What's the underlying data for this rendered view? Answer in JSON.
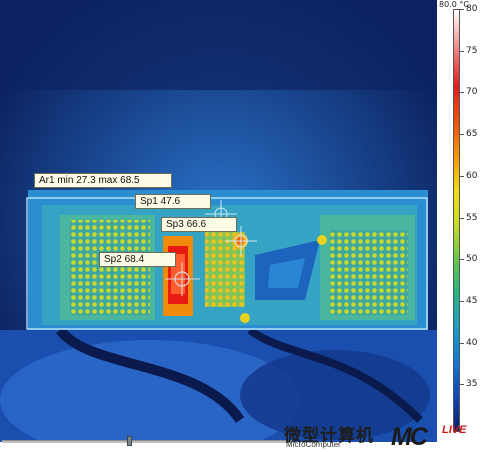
{
  "thermal_image": {
    "area": {
      "label": "Ar1 min 27.3 max 68.5",
      "min": 27.3,
      "max": 68.5
    },
    "spots": [
      {
        "label": "Sp1 47.6",
        "value": 47.6
      },
      {
        "label": "Sp2 68.4",
        "value": 68.4
      },
      {
        "label": "Sp3 66.6",
        "value": 66.6
      }
    ]
  },
  "color_scale": {
    "unit": "80.0 °C",
    "max": 80,
    "ticks": [
      "80",
      "75",
      "70",
      "65",
      "60",
      "55",
      "50",
      "45",
      "40",
      "35"
    ],
    "colors": [
      "#ffffff",
      "#e01d1d",
      "#f59a08",
      "#c6dc26",
      "#27b47e",
      "#1476d6",
      "#0a1d6a"
    ]
  },
  "watermark": {
    "chinese": "微型计算机",
    "english": "MicroComputer",
    "brand": "MC",
    "live": "LIVE"
  }
}
